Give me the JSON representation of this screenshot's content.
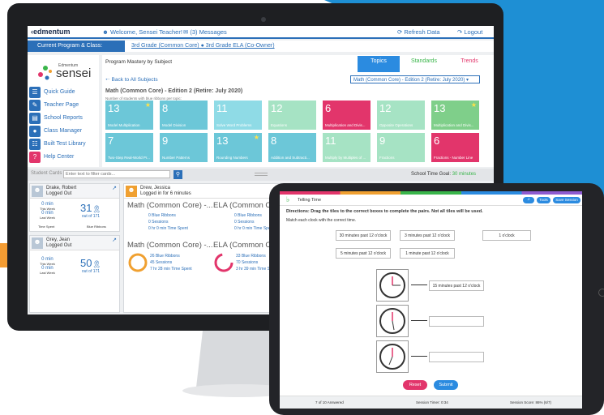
{
  "topbar": {
    "logo": "edmentum",
    "welcome": "Welcome, Sensei Teacher!",
    "messages": "(3) Messages",
    "refresh": "Refresh Data",
    "logout": "Logout"
  },
  "program": {
    "label": "Current Program & Class:",
    "value": "3rd Grade (Common Core) ● 3rd Grade ELA (Co-Owner)"
  },
  "sidebar": {
    "logo_small": "Edmentum",
    "logo_main": "sensei",
    "items": [
      {
        "label": "Quick Guide",
        "icon": "book-icon"
      },
      {
        "label": "Teacher Page",
        "icon": "pencil-icon"
      },
      {
        "label": "School Reports",
        "icon": "report-icon"
      },
      {
        "label": "Class Manager",
        "icon": "people-icon"
      },
      {
        "label": "Built Test Library",
        "icon": "library-icon"
      },
      {
        "label": "Help Center",
        "icon": "help-icon"
      }
    ]
  },
  "panel": {
    "heading": "Program Mastery by Subject",
    "tabs": [
      "Topics",
      "Standards",
      "Trends"
    ],
    "back": "Back to All Subjects",
    "subject_select": "Math (Common Core) - Edition 2 (Retire: July 2020)",
    "title": "Math (Common Core) - Edition 2 (Retire: July 2020)",
    "subtitle": "Number of students with blue ribbons per topic:",
    "tiles": [
      {
        "num": "13",
        "name": "Model Multiplication",
        "color": "#6cc7d8",
        "star": true
      },
      {
        "num": "8",
        "name": "Model Division",
        "color": "#6cc7d8",
        "star": false
      },
      {
        "num": "11",
        "name": "Solve Word Problems",
        "color": "#8fdbe6",
        "star": false
      },
      {
        "num": "12",
        "name": "Equations",
        "color": "#a6e3c4",
        "star": false
      },
      {
        "num": "6",
        "name": "Multiplication and Divis...",
        "color": "#e2356b",
        "star": false
      },
      {
        "num": "12",
        "name": "Opposite Operations",
        "color": "#a6e3c4",
        "star": false
      },
      {
        "num": "13",
        "name": "Multiplication and Divis...",
        "color": "#7fcf8a",
        "star": true
      },
      {
        "num": "7",
        "name": "Two-Step Real-World Pr...",
        "color": "#6cc7d8",
        "star": false
      },
      {
        "num": "9",
        "name": "Number Patterns",
        "color": "#6cc7d8",
        "star": false
      },
      {
        "num": "13",
        "name": "Rounding Numbers",
        "color": "#6cc7d8",
        "star": true
      },
      {
        "num": "8",
        "name": "Addition and Subtracti...",
        "color": "#6cc7d8",
        "star": false
      },
      {
        "num": "11",
        "name": "Multiply by Multiples of ...",
        "color": "#a6e3c4",
        "star": false
      },
      {
        "num": "9",
        "name": "Fractions",
        "color": "#a6e3c4",
        "star": false
      },
      {
        "num": "6",
        "name": "Fractions - Number Line",
        "color": "#e2356b",
        "star": false
      }
    ]
  },
  "filter": {
    "label": "Student Cards",
    "placeholder": "Enter text to filter cards...",
    "goal_prefix": "School Time Goal:",
    "goal_value": "30 minutes"
  },
  "students": [
    {
      "name": "Drake, Robert",
      "status": "Logged Out",
      "week": "0 min",
      "week_label": "This Week",
      "last": "0 min",
      "last_label": "Last Week",
      "ribbons": "31",
      "out_of": "out of 171",
      "foot1": "Time Spent",
      "foot2": "Blue Ribbons"
    },
    {
      "name": "Grey, Jean",
      "status": "Logged Out",
      "week": "0 min",
      "week_label": "This Week",
      "last": "0 min",
      "last_label": "Last Week",
      "ribbons": "50",
      "out_of": "out of 171"
    }
  ],
  "active_student": {
    "name": "Drew, Jessica",
    "status": "Logged in for 6 minutes",
    "blocks": [
      {
        "title": "Math (Common Core) -...",
        "l1": "0 Blue Ribbons",
        "l2": "0 Sessions",
        "l3": "0 hr 0 min Time Spent"
      },
      {
        "title": "ELA (Common Core)",
        "l1": "0 Blue Ribbons",
        "l2": "0 Sessions",
        "l3": "0 hr 0 min Time Spent"
      },
      {
        "title": "Math (Common Core) -...",
        "l1": "26 Blue Ribbons",
        "l2": "45 Sessions",
        "l3": "7 hr 28 min Time Spent"
      },
      {
        "title": "ELA (Common Core)",
        "l1": "33 Blue Ribbons",
        "l2": "70 Sessions",
        "l3": "3 hr 39 min Time Spent"
      }
    ]
  },
  "tablet": {
    "lesson": "Telling Time",
    "tools": "Tools",
    "save": "Save Session",
    "directions": "Directions: Drag the tiles to the correct boxes to complete the pairs. Not all tiles will be used.",
    "instruction": "Match each clock with the correct time.",
    "tiles": [
      "30 minutes past 12 o'clock",
      "3 minutes past 12 o'clock",
      "1 o'clock",
      "5 minutes past 12 o'clock",
      "1 minute past 12 o'clock"
    ],
    "answers": [
      "15 minutes past 12 o'clock",
      "",
      ""
    ],
    "reset": "Reset",
    "submit": "Submit",
    "answered": "7 of 10 Answered",
    "timer": "Session Timer: 0:34",
    "score": "Session Score: 86% (6/7)"
  },
  "colors": {
    "brand_blue": "#2b6fb8",
    "pink": "#e2356b",
    "green": "#39b54a",
    "orange": "#f0a030"
  }
}
